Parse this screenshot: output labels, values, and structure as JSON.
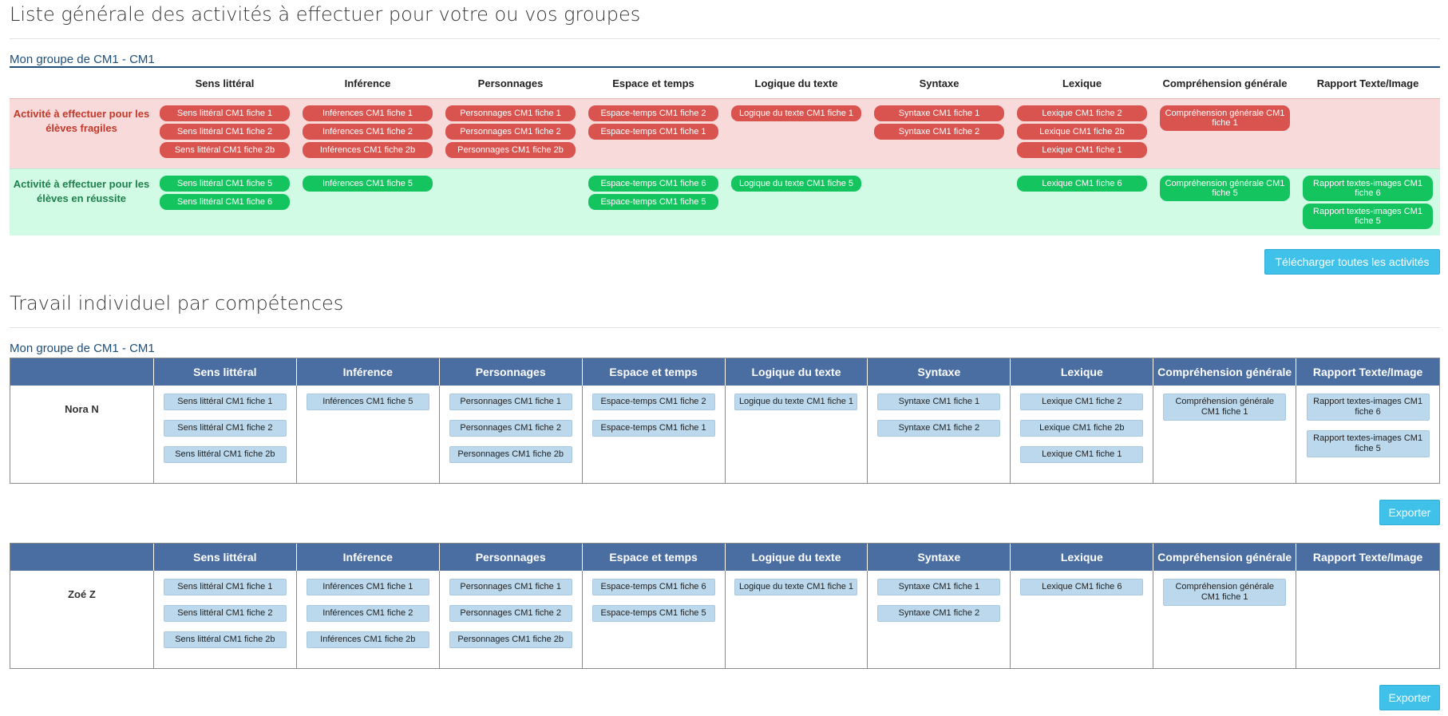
{
  "section1": {
    "title": "Liste générale des activités à effectuer pour votre ou vos groupes",
    "group_label": "Mon groupe de CM1 - CM1"
  },
  "columns": [
    "Sens littéral",
    "Inférence",
    "Personnages",
    "Espace et temps",
    "Logique du texte",
    "Syntaxe",
    "Lexique",
    "Compréhension générale",
    "Rapport Texte/Image"
  ],
  "overview": {
    "fragile": {
      "label": "Activité à effectuer pour les élèves fragiles",
      "cells": [
        [
          "Sens littéral CM1 fiche 1",
          "Sens littéral CM1 fiche 2",
          "Sens littéral CM1 fiche 2b"
        ],
        [
          "Inférences CM1 fiche 1",
          "Inférences CM1 fiche 2",
          "Inférences CM1 fiche 2b"
        ],
        [
          "Personnages CM1 fiche 1",
          "Personnages CM1 fiche 2",
          "Personnages CM1 fiche 2b"
        ],
        [
          "Espace-temps CM1 fiche 2",
          "Espace-temps CM1 fiche 1"
        ],
        [
          "Logique du texte CM1 fiche 1"
        ],
        [
          "Syntaxe CM1 fiche 1",
          "Syntaxe CM1 fiche 2"
        ],
        [
          "Lexique CM1 fiche 2",
          "Lexique CM1 fiche 2b",
          "Lexique CM1 fiche 1"
        ],
        [
          "Compréhension générale CM1 fiche 1"
        ],
        []
      ]
    },
    "success": {
      "label": "Activité à effectuer pour les élèves en réussite",
      "cells": [
        [
          "Sens littéral CM1 fiche 5",
          "Sens littéral CM1 fiche 6"
        ],
        [
          "Inférences CM1 fiche 5"
        ],
        [],
        [
          "Espace-temps CM1 fiche 6",
          "Espace-temps CM1 fiche 5"
        ],
        [
          "Logique du texte CM1 fiche 5"
        ],
        [],
        [
          "Lexique CM1 fiche 6"
        ],
        [
          "Compréhension générale CM1 fiche 5"
        ],
        [
          "Rapport textes-images CM1 fiche 6",
          "Rapport textes-images CM1 fiche 5"
        ]
      ]
    },
    "download_label": "Télécharger toutes les activités"
  },
  "section2": {
    "title": "Travail individuel par compétences",
    "group_label": "Mon groupe de CM1 - CM1"
  },
  "students": [
    {
      "name": "Nora N",
      "export_label": "Exporter",
      "cells": [
        [
          "Sens littéral CM1 fiche 1",
          "Sens littéral CM1 fiche 2",
          "Sens littéral CM1 fiche 2b"
        ],
        [
          "Inférences CM1 fiche 5"
        ],
        [
          "Personnages CM1 fiche 1",
          "Personnages CM1 fiche 2",
          "Personnages CM1 fiche 2b"
        ],
        [
          "Espace-temps CM1 fiche 2",
          "Espace-temps CM1 fiche 1"
        ],
        [
          "Logique du texte CM1 fiche 1"
        ],
        [
          "Syntaxe CM1 fiche 1",
          "Syntaxe CM1 fiche 2"
        ],
        [
          "Lexique CM1 fiche 2",
          "Lexique CM1 fiche 2b",
          "Lexique CM1 fiche 1"
        ],
        [
          "Compréhension générale CM1 fiche 1"
        ],
        [
          "Rapport textes-images CM1 fiche 6",
          "Rapport textes-images CM1 fiche 5"
        ]
      ]
    },
    {
      "name": "Zoé Z",
      "export_label": "Exporter",
      "cells": [
        [
          "Sens littéral CM1 fiche 1",
          "Sens littéral CM1 fiche 2",
          "Sens littéral CM1 fiche 2b"
        ],
        [
          "Inférences CM1 fiche 1",
          "Inférences CM1 fiche 2",
          "Inférences CM1 fiche 2b"
        ],
        [
          "Personnages CM1 fiche 1",
          "Personnages CM1 fiche 2",
          "Personnages CM1 fiche 2b"
        ],
        [
          "Espace-temps CM1 fiche 6",
          "Espace-temps CM1 fiche 5"
        ],
        [
          "Logique du texte CM1 fiche 1"
        ],
        [
          "Syntaxe CM1 fiche 1",
          "Syntaxe CM1 fiche 2"
        ],
        [
          "Lexique CM1 fiche 6"
        ],
        [
          "Compréhension générale CM1 fiche 1"
        ],
        []
      ]
    }
  ],
  "colors": {
    "header_blue": "#4a6ea1",
    "fragile_bg": "#f8dada",
    "success_bg": "#d2fbe6",
    "pill_red": "#d9534f",
    "pill_green": "#13c45f",
    "chip_blue": "#bcd8ec",
    "button_cyan": "#3fc1ea",
    "group_label": "#1f4e79"
  }
}
